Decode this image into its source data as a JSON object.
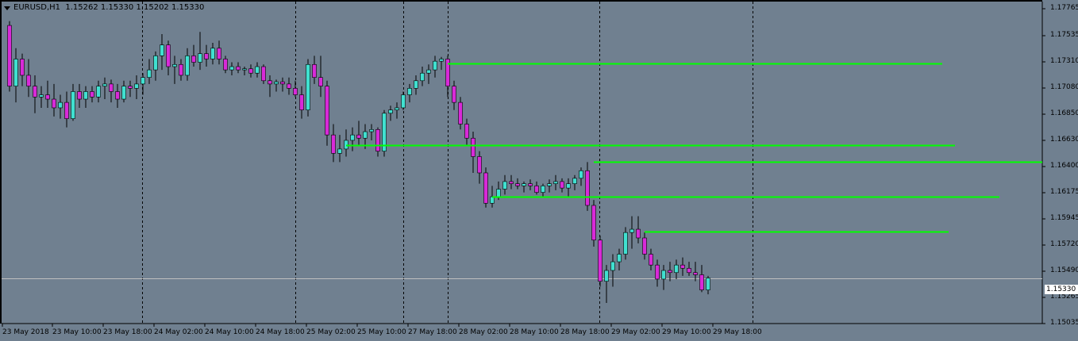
{
  "header": {
    "symbol_timeframe": "EURUSD,H1",
    "ohlc": "1.15262 1.15330 1.15202 1.15330"
  },
  "price_axis": {
    "ticks": [
      "1.17765",
      "1.17535",
      "1.17310",
      "1.17080",
      "1.16850",
      "1.16630",
      "1.16400",
      "1.16175",
      "1.15945",
      "1.15720",
      "1.15490",
      "1.15265",
      "1.15035"
    ],
    "current_price_label": "1.15330"
  },
  "time_axis": {
    "ticks": [
      "23 May 2018",
      "23 May 10:00",
      "23 May 18:00",
      "24 May 02:00",
      "24 May 10:00",
      "24 May 18:00",
      "25 May 02:00",
      "25 May 10:00",
      "27 May 18:00",
      "28 May 02:00",
      "28 May 10:00",
      "28 May 18:00",
      "29 May 02:00",
      "29 May 10:00",
      "29 May 18:00"
    ]
  },
  "colors": {
    "background": "#708090",
    "bull": "#40e0d0",
    "bear": "#d82ad8",
    "level_line": "#00ff00",
    "grid": "#000000",
    "price_line": "#c0c0c0"
  },
  "chart_data": {
    "type": "candlestick",
    "symbol": "EURUSD",
    "timeframe": "H1",
    "candles": [
      [
        1.1766,
        1.177,
        1.1705,
        1.171
      ],
      [
        1.171,
        1.1745,
        1.1695,
        1.1735
      ],
      [
        1.1735,
        1.174,
        1.171,
        1.172
      ],
      [
        1.172,
        1.1735,
        1.17,
        1.171
      ],
      [
        1.171,
        1.172,
        1.1685,
        1.17
      ],
      [
        1.17,
        1.171,
        1.169,
        1.1702
      ],
      [
        1.1702,
        1.1715,
        1.169,
        1.1698
      ],
      [
        1.1698,
        1.1712,
        1.1682,
        1.169
      ],
      [
        1.169,
        1.1702,
        1.168,
        1.1695
      ],
      [
        1.1695,
        1.1705,
        1.1672,
        1.168
      ],
      [
        1.168,
        1.1712,
        1.1678,
        1.1705
      ],
      [
        1.1705,
        1.1712,
        1.169,
        1.1698
      ],
      [
        1.1698,
        1.171,
        1.169,
        1.1705
      ],
      [
        1.1705,
        1.171,
        1.1695,
        1.17
      ],
      [
        1.17,
        1.1715,
        1.1695,
        1.171
      ],
      [
        1.171,
        1.1718,
        1.1698,
        1.1712
      ],
      [
        1.1712,
        1.1716,
        1.1695,
        1.1705
      ],
      [
        1.1705,
        1.1712,
        1.169,
        1.1698
      ],
      [
        1.1698,
        1.1715,
        1.1695,
        1.171
      ],
      [
        1.171,
        1.1715,
        1.17,
        1.1708
      ],
      [
        1.1708,
        1.172,
        1.1698,
        1.1712
      ],
      [
        1.1712,
        1.1722,
        1.1702,
        1.1718
      ],
      [
        1.1718,
        1.1735,
        1.1712,
        1.1725
      ],
      [
        1.1725,
        1.1742,
        1.1715,
        1.1738
      ],
      [
        1.1738,
        1.1758,
        1.1725,
        1.1748
      ],
      [
        1.1748,
        1.1752,
        1.172,
        1.1728
      ],
      [
        1.1728,
        1.1738,
        1.1712,
        1.173
      ],
      [
        1.173,
        1.1735,
        1.1715,
        1.172
      ],
      [
        1.172,
        1.1745,
        1.1715,
        1.1738
      ],
      [
        1.1738,
        1.1748,
        1.1728,
        1.1732
      ],
      [
        1.1732,
        1.176,
        1.1725,
        1.174
      ],
      [
        1.174,
        1.1748,
        1.1728,
        1.1735
      ],
      [
        1.1735,
        1.175,
        1.173,
        1.1745
      ],
      [
        1.1745,
        1.1752,
        1.173,
        1.1735
      ],
      [
        1.1735,
        1.1738,
        1.1722,
        1.1725
      ],
      [
        1.1725,
        1.1732,
        1.172,
        1.1728
      ],
      [
        1.1728,
        1.1732,
        1.1722,
        1.1725
      ],
      [
        1.1725,
        1.1728,
        1.172,
        1.1726
      ],
      [
        1.1726,
        1.173,
        1.1718,
        1.1722
      ],
      [
        1.1722,
        1.1732,
        1.1718,
        1.1728
      ],
      [
        1.1728,
        1.173,
        1.1712,
        1.1715
      ],
      [
        1.1715,
        1.172,
        1.17,
        1.1712
      ],
      [
        1.1712,
        1.1716,
        1.1705,
        1.1714
      ],
      [
        1.1714,
        1.1718,
        1.1705,
        1.1712
      ],
      [
        1.1712,
        1.1718,
        1.1702,
        1.1708
      ],
      [
        1.1708,
        1.1715,
        1.17,
        1.1702
      ],
      [
        1.1702,
        1.171,
        1.168,
        1.1688
      ],
      [
        1.1688,
        1.1735,
        1.1682,
        1.173
      ],
      [
        1.173,
        1.1738,
        1.1712,
        1.1718
      ],
      [
        1.1718,
        1.1738,
        1.17,
        1.171
      ],
      [
        1.171,
        1.1715,
        1.1655,
        1.1665
      ],
      [
        1.1665,
        1.1675,
        1.164,
        1.1648
      ],
      [
        1.1648,
        1.1665,
        1.164,
        1.1652
      ],
      [
        1.1652,
        1.167,
        1.1645,
        1.166
      ],
      [
        1.166,
        1.1672,
        1.165,
        1.1665
      ],
      [
        1.1665,
        1.1678,
        1.1655,
        1.1662
      ],
      [
        1.1662,
        1.1675,
        1.1652,
        1.1668
      ],
      [
        1.1668,
        1.1675,
        1.166,
        1.167
      ],
      [
        1.167,
        1.1672,
        1.1645,
        1.165
      ],
      [
        1.165,
        1.1688,
        1.1645,
        1.1685
      ],
      [
        1.1685,
        1.1692,
        1.1678,
        1.1688
      ],
      [
        1.1688,
        1.1695,
        1.168,
        1.169
      ],
      [
        1.169,
        1.1705,
        1.1688,
        1.1702
      ],
      [
        1.1702,
        1.1712,
        1.1695,
        1.1708
      ],
      [
        1.1708,
        1.172,
        1.1702,
        1.1715
      ],
      [
        1.1715,
        1.1728,
        1.171,
        1.1722
      ],
      [
        1.1722,
        1.173,
        1.1712,
        1.1725
      ],
      [
        1.1725,
        1.1738,
        1.1718,
        1.1733
      ],
      [
        1.1733,
        1.1737,
        1.1725,
        1.1735
      ],
      [
        1.1735,
        1.1738,
        1.17,
        1.171
      ],
      [
        1.171,
        1.1715,
        1.1688,
        1.1695
      ],
      [
        1.1695,
        1.17,
        1.167,
        1.1675
      ],
      [
        1.1675,
        1.168,
        1.1655,
        1.1662
      ],
      [
        1.1662,
        1.1668,
        1.163,
        1.1645
      ],
      [
        1.1645,
        1.165,
        1.162,
        1.163
      ],
      [
        1.163,
        1.1635,
        1.1598,
        1.1602
      ],
      [
        1.1602,
        1.1618,
        1.1598,
        1.1608
      ],
      [
        1.1608,
        1.1622,
        1.1605,
        1.1615
      ],
      [
        1.1615,
        1.1628,
        1.161,
        1.1622
      ],
      [
        1.1622,
        1.1628,
        1.1615,
        1.162
      ],
      [
        1.162,
        1.1625,
        1.1615,
        1.1618
      ],
      [
        1.1618,
        1.1622,
        1.1612,
        1.162
      ],
      [
        1.162,
        1.1624,
        1.1614,
        1.1618
      ],
      [
        1.1618,
        1.1622,
        1.161,
        1.1612
      ],
      [
        1.1612,
        1.162,
        1.1608,
        1.1618
      ],
      [
        1.1618,
        1.1624,
        1.1612,
        1.162
      ],
      [
        1.162,
        1.1628,
        1.1614,
        1.1622
      ],
      [
        1.1622,
        1.1625,
        1.1612,
        1.1616
      ],
      [
        1.1616,
        1.1625,
        1.1608,
        1.162
      ],
      [
        1.162,
        1.1628,
        1.1614,
        1.1625
      ],
      [
        1.1625,
        1.1635,
        1.1618,
        1.1632
      ],
      [
        1.1632,
        1.164,
        1.1595,
        1.16
      ],
      [
        1.16,
        1.1605,
        1.1562,
        1.1568
      ],
      [
        1.1568,
        1.1572,
        1.1525,
        1.153
      ],
      [
        1.153,
        1.1545,
        1.151,
        1.154
      ],
      [
        1.154,
        1.1555,
        1.1525,
        1.1548
      ],
      [
        1.1548,
        1.156,
        1.154,
        1.1555
      ],
      [
        1.1555,
        1.158,
        1.155,
        1.1575
      ],
      [
        1.1575,
        1.159,
        1.156,
        1.1578
      ],
      [
        1.1578,
        1.159,
        1.1565,
        1.157
      ],
      [
        1.157,
        1.1575,
        1.155,
        1.1555
      ],
      [
        1.1555,
        1.156,
        1.154,
        1.1545
      ],
      [
        1.1545,
        1.155,
        1.1525,
        1.1532
      ],
      [
        1.1532,
        1.1545,
        1.1522,
        1.154
      ],
      [
        1.154,
        1.1548,
        1.153,
        1.1538
      ],
      [
        1.1538,
        1.155,
        1.1532,
        1.1545
      ],
      [
        1.1545,
        1.1552,
        1.1535,
        1.1542
      ],
      [
        1.1542,
        1.1548,
        1.1535,
        1.1538
      ],
      [
        1.1538,
        1.1548,
        1.153,
        1.1536
      ],
      [
        1.1536,
        1.1545,
        1.152,
        1.1522
      ],
      [
        1.1522,
        1.1535,
        1.1518,
        1.1533
      ]
    ],
    "levels": [
      {
        "price": 1.1731,
        "from_candle": 69,
        "end_date_label": "29 May 18:00+"
      },
      {
        "price": 1.16555,
        "from_candle": 53,
        "end_date_label": "29 May 18:00+"
      },
      {
        "price": 1.164,
        "from_candle": 92,
        "end_date_label": "29 May 18:00+"
      },
      {
        "price": 1.1608,
        "from_candle": 76,
        "end_date_label": "29 May 18:00+"
      },
      {
        "price": 1.1576,
        "from_candle": 100,
        "end_date_label": "29 May 18:00+"
      }
    ],
    "current_price": 1.1533,
    "y_range": [
      1.1491,
      1.1788
    ]
  }
}
